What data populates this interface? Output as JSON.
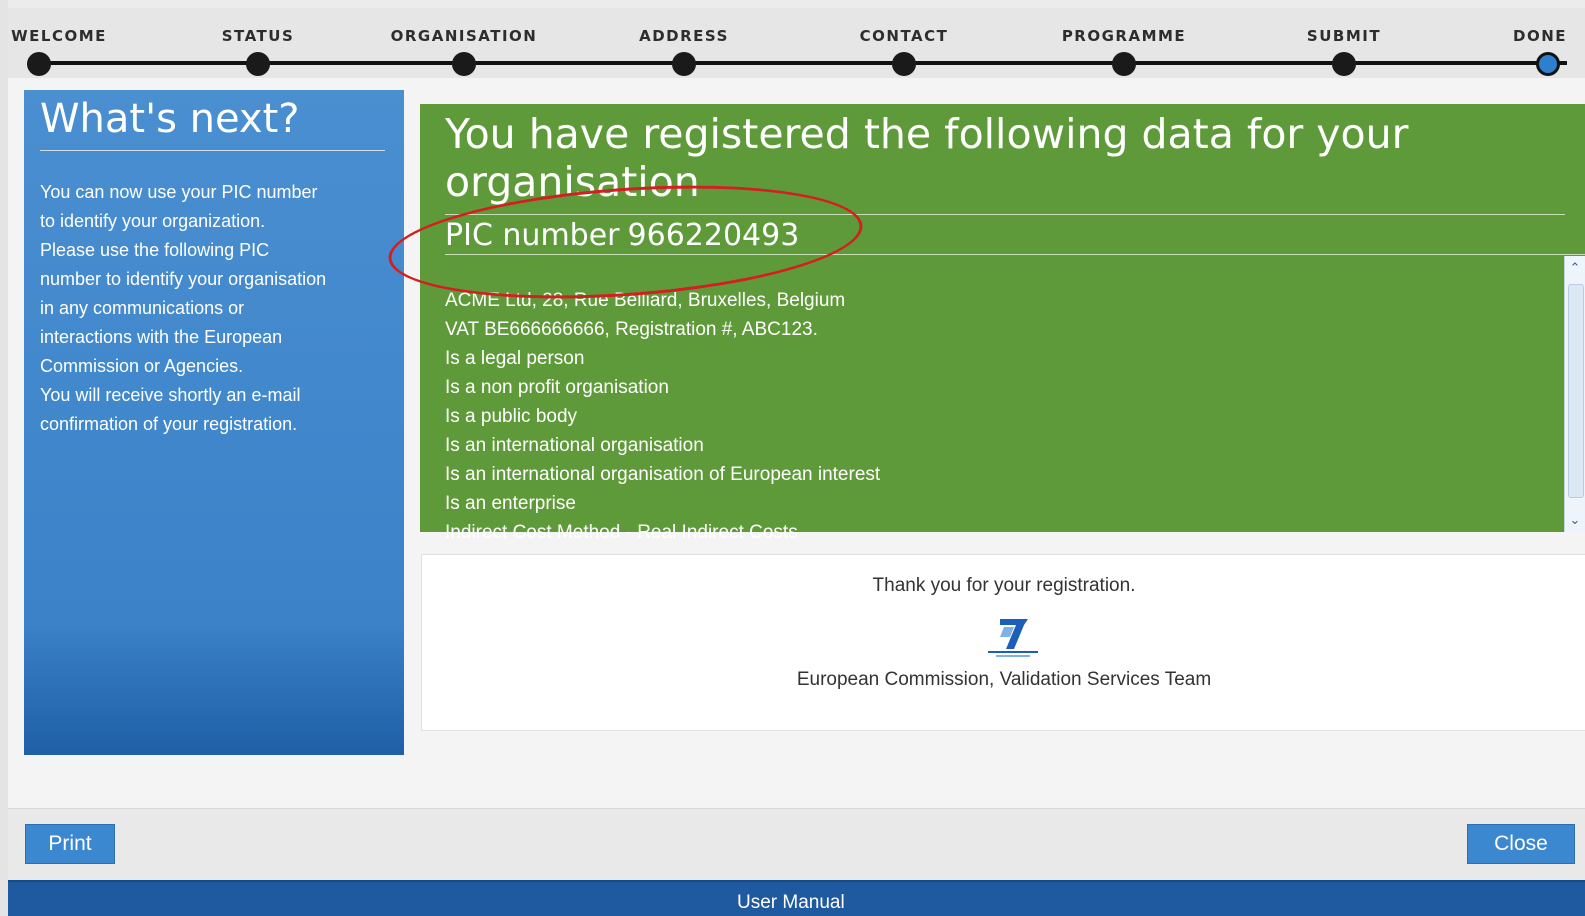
{
  "steps": [
    {
      "label": "WELCOME",
      "state": "done"
    },
    {
      "label": "STATUS",
      "state": "done"
    },
    {
      "label": "ORGANISATION",
      "state": "done"
    },
    {
      "label": "ADDRESS",
      "state": "done"
    },
    {
      "label": "CONTACT",
      "state": "done"
    },
    {
      "label": "PROGRAMME",
      "state": "done"
    },
    {
      "label": "SUBMIT",
      "state": "done"
    },
    {
      "label": "DONE",
      "state": "current"
    }
  ],
  "side_panel": {
    "title": "What's next?",
    "lines": [
      "You can now use your PIC number",
      "to identify your organization.",
      "Please use the following PIC",
      "number to identify your organisation",
      "in any communications or",
      "interactions with the European",
      "Commission or Agencies.",
      "You will receive shortly an e-mail",
      "confirmation of your registration."
    ]
  },
  "registered": {
    "heading": "You have registered the following data for your organisation",
    "pic_label": "PIC number",
    "pic_value": "966220493",
    "details": [
      "ACME Ltd, 28, Rue Belliard, Bruxelles, Belgium",
      "VAT BE666666666, Registration #, ABC123.",
      "Is a legal person",
      "Is a non profit organisation",
      "Is a public body",
      "Is an international organisation",
      "Is an international organisation of European interest",
      "Is an enterprise",
      "Indirect Cost Method - Real Indirect Costs"
    ]
  },
  "thanks": {
    "message": "Thank you for your registration.",
    "logo_icon": "fp7-logo-icon",
    "team": "European Commission, Validation Services Team"
  },
  "buttons": {
    "print": "Print",
    "close": "Close"
  },
  "footer": {
    "manual": "User Manual"
  },
  "colors": {
    "side_panel": "#3b82c9",
    "data_panel": "#5f9a3a",
    "annotation_circle": "#d31f1f",
    "bottom_bar": "#1f5aa0"
  }
}
